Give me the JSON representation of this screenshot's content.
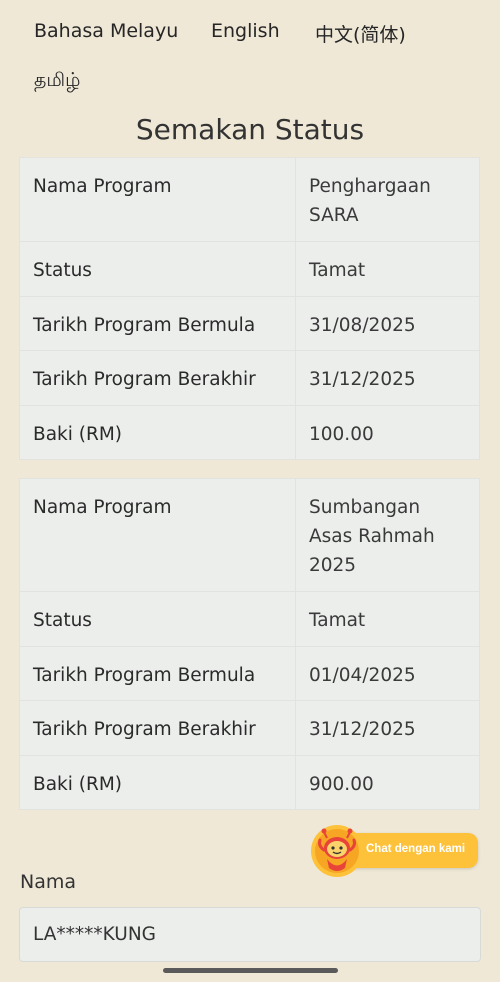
{
  "languages": [
    "Bahasa Melayu",
    "English",
    "中文(简体)",
    "தமிழ்"
  ],
  "page_title": "Semakan Status",
  "programs": [
    {
      "rows": [
        {
          "label": "Nama Program",
          "value": "Penghargaan SARA"
        },
        {
          "label": "Status",
          "value": "Tamat"
        },
        {
          "label": "Tarikh Program Bermula",
          "value": "31/08/2025"
        },
        {
          "label": "Tarikh Program Berakhir",
          "value": "31/12/2025"
        },
        {
          "label": "Baki (RM)",
          "value": "100.00"
        }
      ]
    },
    {
      "rows": [
        {
          "label": "Nama Program",
          "value": "Sumbangan Asas Rahmah 2025"
        },
        {
          "label": "Status",
          "value": "Tamat"
        },
        {
          "label": "Tarikh Program Bermula",
          "value": "01/04/2025"
        },
        {
          "label": "Tarikh Program Berakhir",
          "value": "31/12/2025"
        },
        {
          "label": "Baki (RM)",
          "value": "900.00"
        }
      ]
    }
  ],
  "chat": {
    "label": "Chat dengan kami",
    "icon": "chatbot-mascot-icon",
    "color": "#fdc13a"
  },
  "name_field": {
    "label": "Nama",
    "value": "LA*****KUNG"
  },
  "colors": {
    "background": "#efe8d7",
    "table_background": "#eceeec"
  }
}
